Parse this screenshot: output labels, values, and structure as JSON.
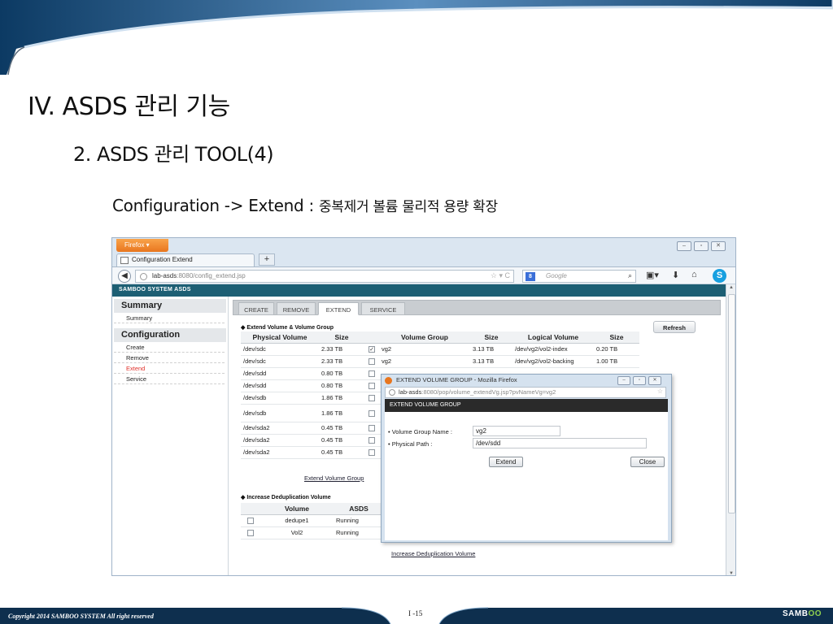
{
  "slide": {
    "heading1": "IV. ASDS 관리 기능",
    "heading2": "2. ASDS 관리 TOOL(4)",
    "heading3_en": "Configuration -> Extend : ",
    "heading3_ko": "중복제거 볼륨 물리적 용량 확장",
    "copyright": "Copyright 2014 SAMBOO SYSTEM All right reserved",
    "page_number": "I -15",
    "logo_main": "SAMB",
    "logo_accent": "OO"
  },
  "browser": {
    "menu_button": "Firefox ▾",
    "tab_title": "Configuration Extend",
    "new_tab": "+",
    "url_host": "lab-asds",
    "url_path": ":8080/config_extend.jsp",
    "search_placeholder": "Google",
    "search_engine": "8",
    "app_title": "SAMBOO SYSTEM ASDS",
    "colors": {
      "app_bar": "#1d5f74",
      "firefox_orange": "#e8761f",
      "active_link": "#e0312b"
    }
  },
  "sidebar": {
    "sections": [
      {
        "title": "Summary",
        "items": [
          {
            "label": "Summary",
            "active": false
          }
        ]
      },
      {
        "title": "Configuration",
        "items": [
          {
            "label": "Create",
            "active": false
          },
          {
            "label": "Remove",
            "active": false
          },
          {
            "label": "Extend",
            "active": true
          },
          {
            "label": "Service",
            "active": false
          }
        ]
      }
    ]
  },
  "main": {
    "tabs": [
      "CREATE",
      "REMOVE",
      "EXTEND",
      "SERVICE"
    ],
    "selected_tab": "EXTEND",
    "refresh_label": "Refresh",
    "extend_section_title": "◆ Extend Volume & Volume Group",
    "pv_headers": [
      "Physical Volume",
      "Size"
    ],
    "vg_headers": [
      "Volume Group",
      "Size",
      "Logical Volume",
      "Size"
    ],
    "pv_rows": [
      {
        "pv": "/dev/sdc",
        "size": "2.33 TB",
        "checked": true,
        "vg": "vg2",
        "vg_size": "3.13 TB",
        "lv": "/dev/vg2/vol2-index",
        "lv_size": "0.20 TB"
      },
      {
        "pv": "/dev/sdc",
        "size": "2.33 TB",
        "checked": false,
        "vg": "vg2",
        "vg_size": "3.13 TB",
        "lv": "/dev/vg2/vol2-backing",
        "lv_size": "1.00 TB"
      },
      {
        "pv": "/dev/sdd",
        "size": "0.80 TB",
        "checked": false
      },
      {
        "pv": "/dev/sdd",
        "size": "0.80 TB",
        "checked": false
      },
      {
        "pv": "/dev/sdb",
        "size": "1.86 TB",
        "checked": false
      },
      {
        "pv": "/dev/sdb",
        "size": "1.86 TB",
        "checked": false
      },
      {
        "pv": "/dev/sda2",
        "size": "0.45 TB",
        "checked": false
      },
      {
        "pv": "/dev/sda2",
        "size": "0.45 TB",
        "checked": false
      },
      {
        "pv": "/dev/sda2",
        "size": "0.45 TB",
        "checked": false
      }
    ],
    "extend_vg_link": "Extend Volume Group",
    "dedup_section_title": "◆ Increase Deduplication Volume",
    "dedup_headers": [
      "Volume",
      "ASDS"
    ],
    "dedup_rows": [
      {
        "volume": "dedupe1",
        "status": "Running"
      },
      {
        "volume": "Vol2",
        "status": "Running"
      }
    ],
    "increase_link": "Increase Deduplication Volume"
  },
  "popup": {
    "window_title": "EXTEND VOLUME GROUP - Mozilla Firefox",
    "url_host": "lab-asds",
    "url_path": ":8080/pop/volume_extendVg.jsp?pvNameVg=vg2",
    "header": "EXTEND VOLUME GROUP",
    "vg_name_label": "• Volume Group Name :",
    "vg_name_value": "vg2",
    "path_label": "• Physical Path :",
    "path_value": "/dev/sdd",
    "extend_button": "Extend",
    "close_button": "Close"
  }
}
